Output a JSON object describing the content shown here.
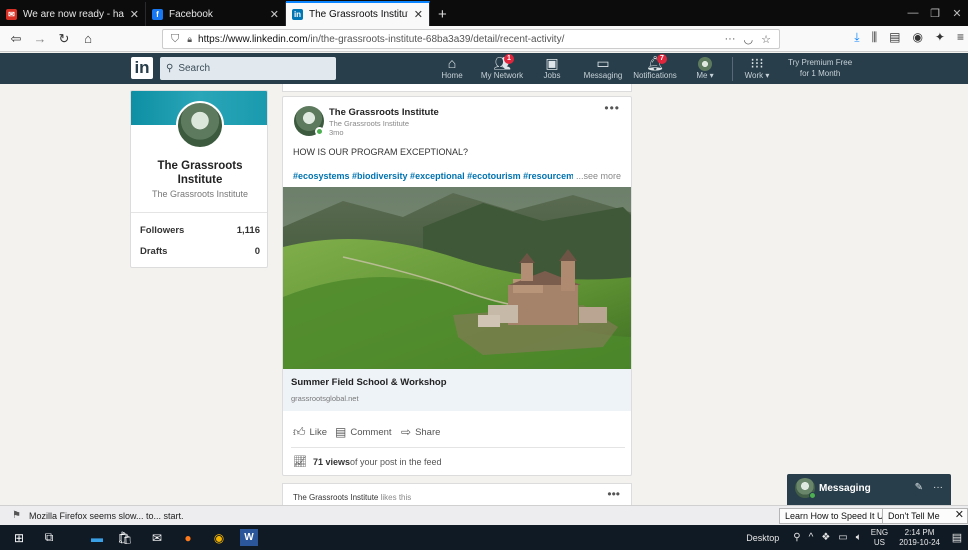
{
  "browser": {
    "tabs": [
      {
        "title": "We are now ready - harjjumen",
        "favicon": "mail-icon",
        "color": "#d93025"
      },
      {
        "title": "Facebook",
        "favicon": "facebook-icon",
        "color": "#1877f2"
      },
      {
        "title": "The Grassroots Institute | Linke",
        "favicon": "linkedin-icon",
        "color": "#0077b5",
        "active": true
      }
    ],
    "new_tab": "+",
    "url_host": "https://www.linkedin.com",
    "url_path": "/in/the-grassroots-institute-68ba3a39/detail/recent-activity/",
    "url_actions": "···"
  },
  "linkedin": {
    "logo": "in",
    "search_placeholder": "Search",
    "nav": [
      {
        "label": "Home",
        "icon": "home-icon"
      },
      {
        "label": "My Network",
        "icon": "network-icon",
        "badge": "1"
      },
      {
        "label": "Jobs",
        "icon": "jobs-icon"
      },
      {
        "label": "Messaging",
        "icon": "messaging-icon"
      },
      {
        "label": "Notifications",
        "icon": "bell-icon",
        "badge": "7"
      },
      {
        "label": "Me ▾",
        "icon": "avatar-icon"
      },
      {
        "label": "Work ▾",
        "icon": "grid-icon"
      }
    ],
    "premium_line1": "Try Premium Free",
    "premium_line2": "for 1 Month"
  },
  "profile": {
    "name": "The Grassroots Institute",
    "subtitle": "The Grassroots Institute",
    "stats": [
      {
        "label": "Followers",
        "value": "1,116"
      },
      {
        "label": "Drafts",
        "value": "0"
      }
    ]
  },
  "post": {
    "author": "The Grassroots Institute",
    "author_sub": "The Grassroots Institute",
    "time": "3mo",
    "more": "•••",
    "text": "HOW IS OUR PROGRAM EXCEPTIONAL?",
    "tags": "#ecosystems #biodiversity #exceptional #ecotourism #resourcemanag",
    "see_more": "...see more",
    "link_title": "Summer Field School & Workshop",
    "link_domain": "grassrootsglobal.net",
    "actions": {
      "like": "Like",
      "comment": "Comment",
      "share": "Share"
    },
    "views_count": "71 views",
    "views_rest": " of your post in the feed"
  },
  "next_card": {
    "author": "The Grassroots Institute",
    "rest": " likes this",
    "more": "•••"
  },
  "messaging": {
    "label": "Messaging"
  },
  "notification": {
    "text": "Mozilla Firefox seems slow... to... start.",
    "button1": "Learn How to Speed It Up",
    "button2": "Don't Tell Me Again",
    "close": "✕"
  },
  "taskbar": {
    "desktop": "Desktop",
    "lang1": "ENG",
    "lang2": "US",
    "time": "2:14 PM",
    "date": "2019-10-24"
  }
}
